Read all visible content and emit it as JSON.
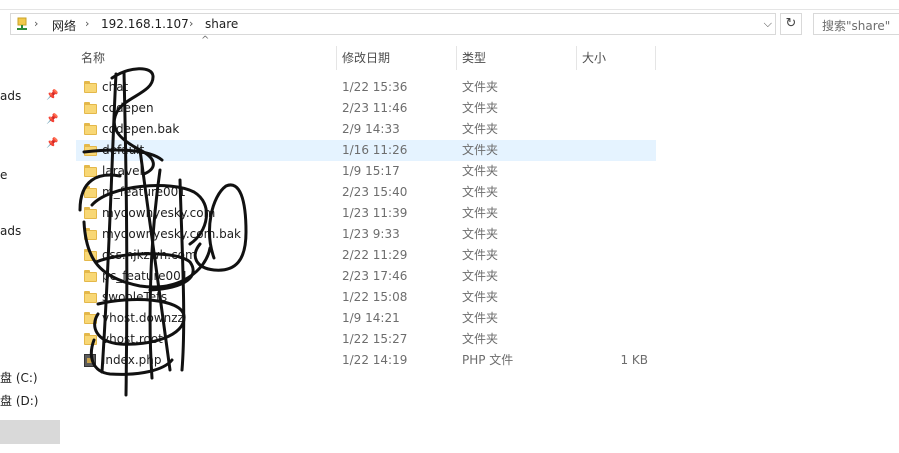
{
  "address": {
    "crumbs": [
      "网络",
      "192.168.1.107",
      "share"
    ],
    "separator": "›",
    "dropdown": "⌵",
    "refresh": "↻"
  },
  "search": {
    "placeholder": "搜索\"share\""
  },
  "nav": {
    "items": [
      {
        "label": "ads",
        "pinned": true
      },
      {
        "label": "",
        "pinned": true
      },
      {
        "label": "",
        "pinned": true
      },
      {
        "label": "e",
        "pinned": false
      },
      {
        "label": "ads",
        "pinned": false
      },
      {
        "label": "盘 (C:)",
        "pinned": false
      },
      {
        "label": "盘 (D:)",
        "pinned": false
      }
    ]
  },
  "columns": {
    "name": "名称",
    "date": "修改日期",
    "type": "类型",
    "size": "大小"
  },
  "files": [
    {
      "name": "chat",
      "date": "1/22 15:36",
      "type": "文件夹",
      "size": "",
      "icon": "folder-icon"
    },
    {
      "name": "codepen",
      "date": "2/23 11:46",
      "type": "文件夹",
      "size": "",
      "icon": "folder-icon"
    },
    {
      "name": "codepen.bak",
      "date": "2/9 14:33",
      "type": "文件夹",
      "size": "",
      "icon": "folder-icon"
    },
    {
      "name": "default",
      "date": "1/16 11:26",
      "type": "文件夹",
      "size": "",
      "icon": "folder-icon",
      "selected": true
    },
    {
      "name": "laravel",
      "date": "1/9 15:17",
      "type": "文件夹",
      "size": "",
      "icon": "folder-icon"
    },
    {
      "name": "m_feature001",
      "date": "2/23 15:40",
      "type": "文件夹",
      "size": "",
      "icon": "folder-icon"
    },
    {
      "name": "mydownyesky.com",
      "date": "1/23 11:39",
      "type": "文件夹",
      "size": "",
      "icon": "folder-icon"
    },
    {
      "name": "mydownyesky.com.bak",
      "date": "1/23 9:33",
      "type": "文件夹",
      "size": "",
      "icon": "folder-icon"
    },
    {
      "name": "oss.njkzwh.com",
      "date": "2/22 11:29",
      "type": "文件夹",
      "size": "",
      "icon": "folder-icon"
    },
    {
      "name": "pc_feature001",
      "date": "2/23 17:46",
      "type": "文件夹",
      "size": "",
      "icon": "folder-icon"
    },
    {
      "name": "swooleTets",
      "date": "1/22 15:08",
      "type": "文件夹",
      "size": "",
      "icon": "folder-icon"
    },
    {
      "name": "vhost.downzz",
      "date": "1/9 14:21",
      "type": "文件夹",
      "size": "",
      "icon": "folder-icon"
    },
    {
      "name": "vhost.root",
      "date": "1/22 15:27",
      "type": "文件夹",
      "size": "",
      "icon": "folder-icon"
    },
    {
      "name": "index.php",
      "date": "1/22 14:19",
      "type": "PHP 文件",
      "size": "1 KB",
      "icon": "php-file-icon"
    }
  ]
}
